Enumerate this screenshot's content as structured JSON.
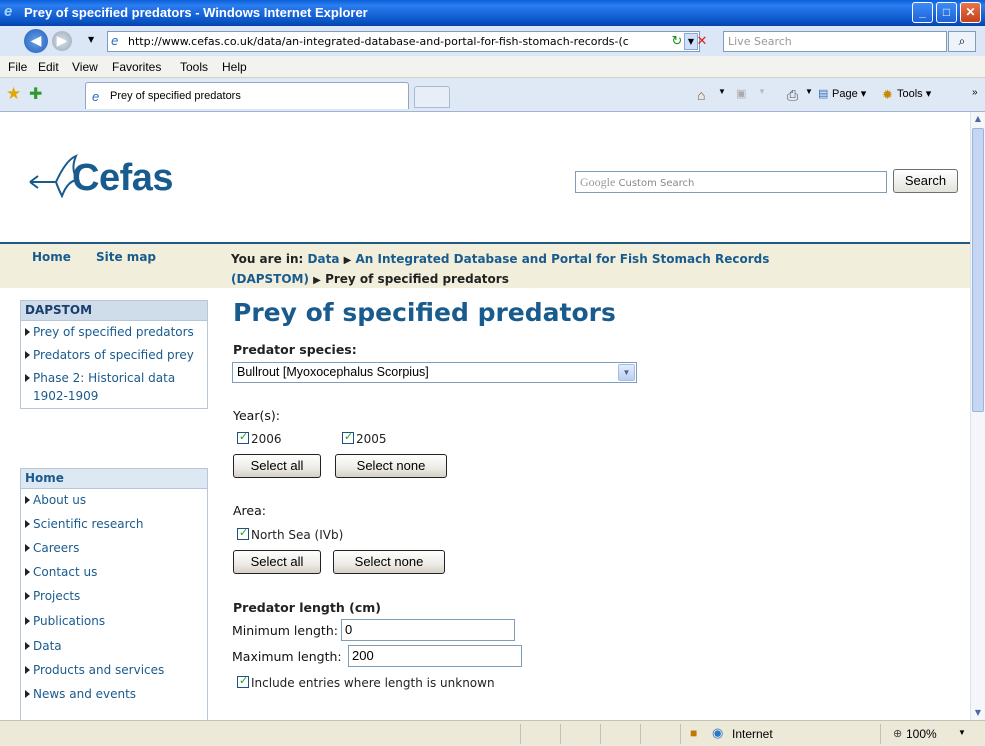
{
  "window": {
    "title": "Prey of specified predators - Windows Internet Explorer",
    "minimize": "_",
    "maximize": "□",
    "close": "✕"
  },
  "addressbar": {
    "url": "http://www.cefas.co.uk/data/an-integrated-database-and-portal-for-fish-stomach-records-(c",
    "search_placeholder": "Live Search"
  },
  "menubar": [
    "File",
    "Edit",
    "View",
    "Favorites",
    "Tools",
    "Help"
  ],
  "tabs": {
    "active": "Prey of specified predators"
  },
  "commandbar": {
    "page": "Page",
    "tools": "Tools"
  },
  "site": {
    "logo": "Cefas",
    "search_placeholder": "Custom Search",
    "search_brand": "Google",
    "search_button": "Search"
  },
  "topnav": {
    "home": "Home",
    "sitemap": "Site map"
  },
  "breadcrumb": {
    "label": "You are in:",
    "items": [
      "Data",
      "An Integrated Database and Portal for Fish Stomach Records (DAPSTOM)",
      "Prey of specified predators"
    ]
  },
  "sidebar": {
    "section1": {
      "title": "DAPSTOM",
      "items": [
        "Prey of specified predators",
        "Predators of specified prey",
        "Phase 2: Historical data 1902-1909"
      ]
    },
    "section2": {
      "title": "Home",
      "items": [
        "About us",
        "Scientific research",
        "Careers",
        "Contact us",
        "Projects",
        "Publications",
        "Data",
        "Products and services",
        "News and events"
      ]
    }
  },
  "main": {
    "title": "Prey of specified predators",
    "predator_label": "Predator species:",
    "predator_value": "Bullrout [Myoxocephalus Scorpius]",
    "years_label": "Year(s):",
    "years": [
      "2006",
      "2005"
    ],
    "select_all": "Select all",
    "select_none": "Select none",
    "area_label": "Area:",
    "area": "North Sea (IVb)",
    "length_label": "Predator length (cm)",
    "min_label": "Minimum length:",
    "min_value": "0",
    "max_label": "Maximum length:",
    "max_value": "200",
    "unknown_label": "Include entries where length is unknown"
  },
  "statusbar": {
    "zone": "Internet",
    "zoom": "100%"
  }
}
